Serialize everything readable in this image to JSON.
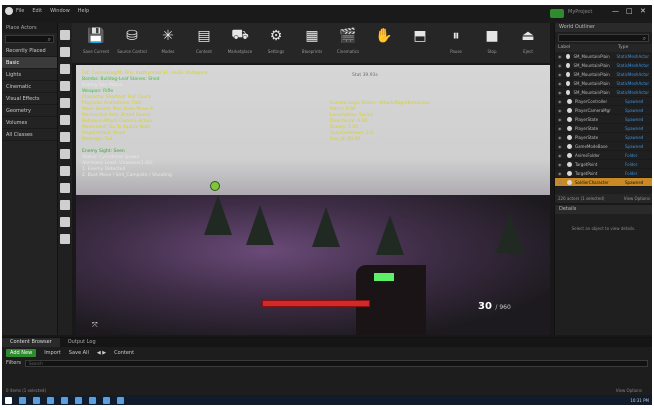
{
  "menubar": [
    "File",
    "Edit",
    "Window",
    "Help"
  ],
  "window": {
    "minimize": "—",
    "maximize": "□",
    "close": "✕",
    "project_name": "MyProject"
  },
  "modes": {
    "header": "Place Actors",
    "categories": [
      "Recently Placed",
      "Basic",
      "Lights",
      "Cinematic",
      "Visual Effects",
      "Geometry",
      "Volumes",
      "All Classes"
    ],
    "selected": 1
  },
  "toolbar": [
    {
      "icon": "save-icon",
      "glyph": "💾",
      "label": "Save Current"
    },
    {
      "icon": "source-control-icon",
      "glyph": "⛁",
      "label": "Source Control"
    },
    {
      "icon": "modes-icon",
      "glyph": "✳",
      "label": "Modes"
    },
    {
      "icon": "content-icon",
      "glyph": "▤",
      "label": "Content"
    },
    {
      "icon": "marketplace-icon",
      "glyph": "⛟",
      "label": "Marketplace"
    },
    {
      "icon": "settings-icon",
      "glyph": "⚙",
      "label": "Settings"
    },
    {
      "icon": "blueprints-icon",
      "glyph": "▦",
      "label": "Blueprints"
    },
    {
      "icon": "cinematics-icon",
      "glyph": "🎬",
      "label": "Cinematics"
    },
    {
      "icon": "build-icon",
      "glyph": "✋",
      "label": ""
    },
    {
      "icon": "compile-icon",
      "glyph": "⬒",
      "label": ""
    },
    {
      "icon": "pause-icon",
      "glyph": "⏸",
      "label": "Pause"
    },
    {
      "icon": "stop-icon",
      "glyph": "■",
      "label": "Stop"
    },
    {
      "icon": "eject-icon",
      "glyph": "⏏",
      "label": "Eject"
    }
  ],
  "viewport": {
    "hud_top": "Stat 39.93s",
    "left_lines": [
      {
        "c": "y",
        "t": "Fat: Curreaking/M: Fire: mathy/mail SF: HeGh: Kategorie"
      },
      {
        "c": "g",
        "t": "Bombs: Bulldog-Leaf Stones: Shed"
      },
      {
        "c": "w",
        "t": "Enemy Set: Patrol"
      },
      {
        "c": "g",
        "t": "Weapon: Rifle"
      },
      {
        "c": "y",
        "t": "Charactar Shortcut: FoV Count"
      },
      {
        "c": "y",
        "t": "Playcolor Animations: Path"
      },
      {
        "c": "y",
        "t": "Move Sound: Pass Base Move.9"
      },
      {
        "c": "y",
        "t": "Mechanical Arm: Brand Sound"
      },
      {
        "c": "y",
        "t": "Behavior-Attack Camera Action"
      },
      {
        "c": "y",
        "t": "Movement: Go To Spatial Note"
      },
      {
        "c": "y",
        "t": "PlayerAttack: Pistol"
      },
      {
        "c": "y",
        "t": "Message: Fail"
      },
      {
        "c": "w",
        "t": ""
      },
      {
        "c": "dg",
        "t": "Enemy Sight: Seen"
      },
      {
        "c": "w",
        "t": "Status: Cylindrical Spawn"
      },
      {
        "c": "w",
        "t": "Alertness Level: Unaware(1.00)"
      },
      {
        "c": "w",
        "t": "1. Enemy Detected"
      },
      {
        "c": "w",
        "t": "2. Bust Move  /  Sml_Campsite  /  Shooting"
      }
    ],
    "right_lines": [
      {
        "c": "y",
        "t": "Current Logic Status: Attack/BeginBehaviour"
      },
      {
        "c": "y",
        "t": "Patrol: 0.00"
      },
      {
        "c": "y",
        "t": "Locomotion: Sprint"
      },
      {
        "c": "y",
        "t": "Directional: 0.00"
      },
      {
        "c": "y",
        "t": "Enemy: 1.00"
      },
      {
        "c": "y",
        "t": "ScanCooldown: 2.0"
      },
      {
        "c": "y",
        "t": "Fire_Id: 00.00"
      }
    ],
    "ammo": "30",
    "ammo_max": "/ 960",
    "health_fraction": 1.0
  },
  "outliner": {
    "header": "World Outliner",
    "columns": [
      "Label",
      "Type"
    ],
    "rows": [
      {
        "label": "SM_MountainPlain",
        "type": "StaticMeshActor",
        "sel": false
      },
      {
        "label": "SM_MountainPlain",
        "type": "StaticMeshActor",
        "sel": false
      },
      {
        "label": "SM_MountainPlain",
        "type": "StaticMeshActor",
        "sel": false
      },
      {
        "label": "SM_MountainPlain",
        "type": "StaticMeshActor",
        "sel": false
      },
      {
        "label": "SM_MountainPlain",
        "type": "StaticMeshActor",
        "sel": false
      },
      {
        "label": "PlayerController",
        "type": "Spawned",
        "sel": false
      },
      {
        "label": "PlayerCameraMgr",
        "type": "Spawned",
        "sel": false
      },
      {
        "label": "PlayerState",
        "type": "Spawned",
        "sel": false
      },
      {
        "label": "PlayerState",
        "type": "Spawned",
        "sel": false
      },
      {
        "label": "PlayerState",
        "type": "Spawned",
        "sel": false
      },
      {
        "label": "GameModeBase",
        "type": "Spawned",
        "sel": false
      },
      {
        "label": "AnimsFolder",
        "type": "Folder",
        "sel": false
      },
      {
        "label": "TargetPoint",
        "type": "Folder",
        "sel": false
      },
      {
        "label": "TargetPoint",
        "type": "Folder",
        "sel": false
      },
      {
        "label": "SoldierCharacter",
        "type": "Spawned",
        "sel": true
      }
    ],
    "footer_count": "226 actors (1 selected)",
    "footer_view": "View Options"
  },
  "details": {
    "header": "Details",
    "message": "Select an object to view details."
  },
  "content": {
    "tabs": [
      "Content Browser",
      "Output Log"
    ],
    "add_new": "Add New",
    "import": "Import",
    "save_all": "Save All",
    "content_path": "Content",
    "filters": "Filters",
    "search_placeholder": "Search",
    "footer": "0 items (1 selected)",
    "view_options": "View Options"
  },
  "taskbar": {
    "tray_time": "10:31 PM"
  }
}
